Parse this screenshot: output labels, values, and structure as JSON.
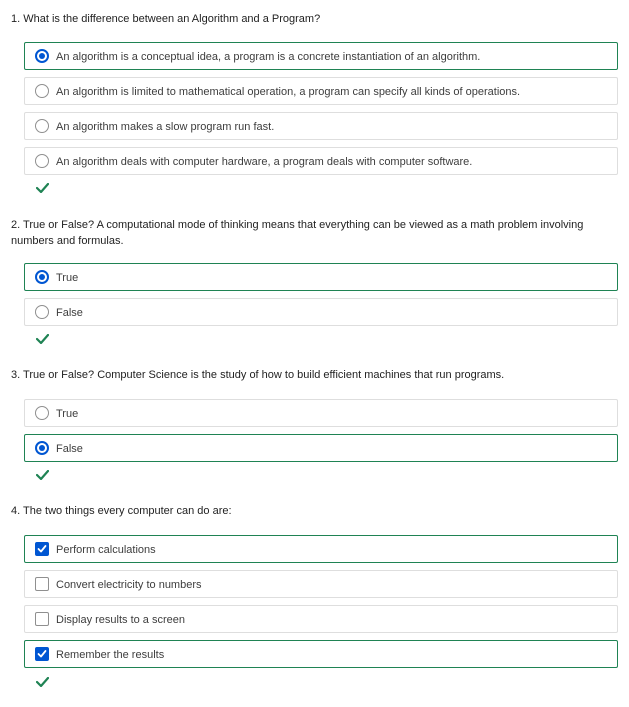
{
  "questions": [
    {
      "text": "1. What is the difference between an Algorithm and a Program?",
      "type": "radio",
      "options": [
        {
          "label": "An algorithm is a conceptual idea, a program is a concrete instantiation of an algorithm.",
          "selected": true
        },
        {
          "label": "An algorithm is limited to mathematical operation, a program can specify all kinds of operations.",
          "selected": false
        },
        {
          "label": "An algorithm makes a slow program run fast.",
          "selected": false
        },
        {
          "label": "An algorithm deals with computer hardware, a program deals with computer software.",
          "selected": false
        }
      ],
      "result": "correct"
    },
    {
      "text": "2. True or False? A computational mode of thinking means that everything can be viewed as a math problem involving numbers and formulas.",
      "type": "radio",
      "options": [
        {
          "label": "True",
          "selected": true
        },
        {
          "label": "False",
          "selected": false
        }
      ],
      "result": "correct"
    },
    {
      "text": "3. True or False? Computer Science is the study of how to build efficient machines that run programs.",
      "type": "radio",
      "options": [
        {
          "label": "True",
          "selected": false
        },
        {
          "label": "False",
          "selected": true
        }
      ],
      "result": "correct"
    },
    {
      "text": "4. The two things every computer can do are:",
      "type": "checkbox",
      "options": [
        {
          "label": "Perform calculations",
          "selected": true
        },
        {
          "label": "Convert electricity to numbers",
          "selected": false
        },
        {
          "label": "Display results to a screen",
          "selected": false
        },
        {
          "label": "Remember the results",
          "selected": true
        }
      ],
      "result": "correct"
    }
  ],
  "colors": {
    "accent": "#0056d2",
    "correct": "#1f8354",
    "border": "#dedede"
  },
  "icons": {
    "correct": "checkmark-icon",
    "checkbox_checked": "checkbox-checked-icon"
  }
}
